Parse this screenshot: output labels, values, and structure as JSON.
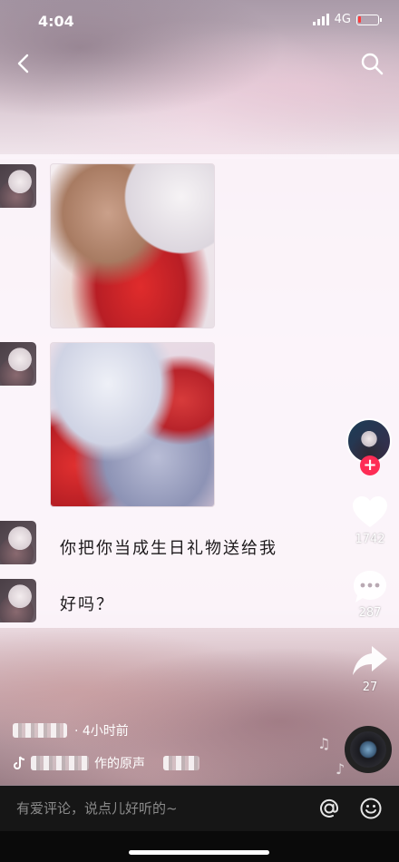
{
  "status_bar": {
    "time": "4:04",
    "network": "4G",
    "battery_level": 0.15,
    "battery_color": "#ff3b3b"
  },
  "nav": {
    "back_icon": "chevron-left-icon",
    "search_icon": "search-icon"
  },
  "chat": {
    "messages": [
      {
        "type": "image",
        "icon": "avatar-icon"
      },
      {
        "type": "image",
        "icon": "avatar-icon"
      },
      {
        "type": "text",
        "text": "你把你当成生日礼物送给我"
      },
      {
        "type": "text",
        "text": "好吗？"
      }
    ]
  },
  "sidebar": {
    "follow_label": "+",
    "like_count": "1742",
    "comment_count": "287",
    "share_count": "27",
    "accent_color": "#fe2c55"
  },
  "caption": {
    "time_ago": "· 4小时前",
    "music_suffix": "作的原声"
  },
  "comment_bar": {
    "placeholder": "有爱评论，说点儿好听的~",
    "at_icon": "at-icon",
    "emoji_icon": "emoji-icon"
  }
}
